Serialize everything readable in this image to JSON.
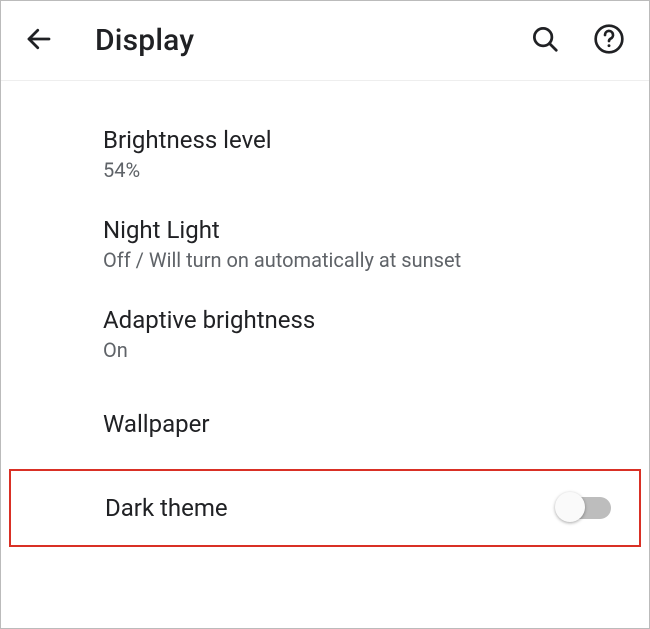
{
  "header": {
    "title": "Display"
  },
  "items": {
    "brightness": {
      "title": "Brightness level",
      "subtitle": "54%"
    },
    "nightLight": {
      "title": "Night Light",
      "subtitle": "Off / Will turn on automatically at sunset"
    },
    "adaptive": {
      "title": "Adaptive brightness",
      "subtitle": "On"
    },
    "wallpaper": {
      "title": "Wallpaper"
    },
    "darkTheme": {
      "title": "Dark theme",
      "enabled": false
    }
  }
}
